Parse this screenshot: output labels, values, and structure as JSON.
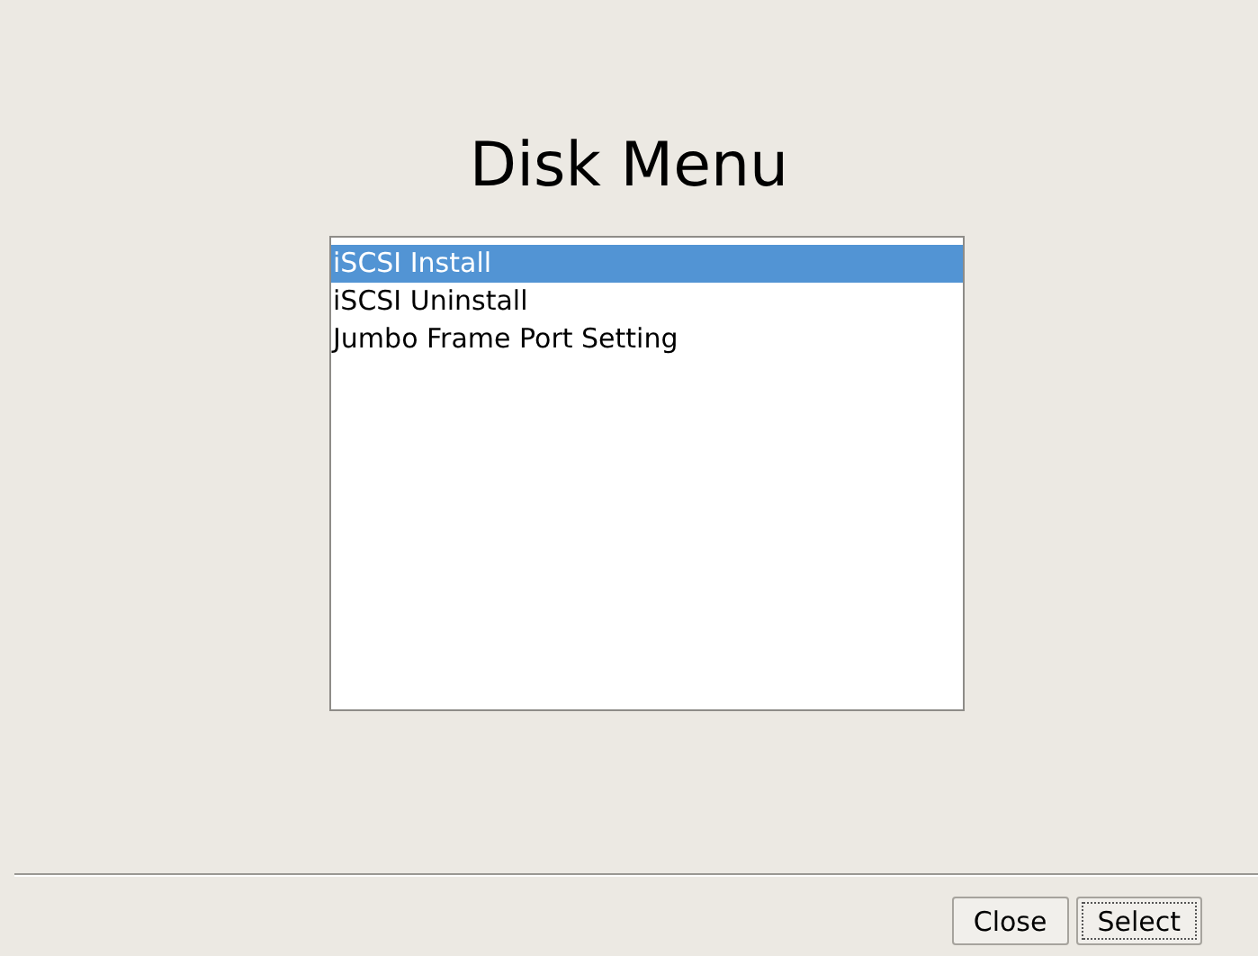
{
  "title": "Disk Menu",
  "list": {
    "items": [
      {
        "label": "iSCSI Install",
        "selected": true
      },
      {
        "label": "iSCSI Uninstall",
        "selected": false
      },
      {
        "label": "Jumbo Frame Port Setting",
        "selected": false
      }
    ]
  },
  "buttons": [
    {
      "label": "Close",
      "focused": false
    },
    {
      "label": "Select",
      "focused": true
    }
  ]
}
